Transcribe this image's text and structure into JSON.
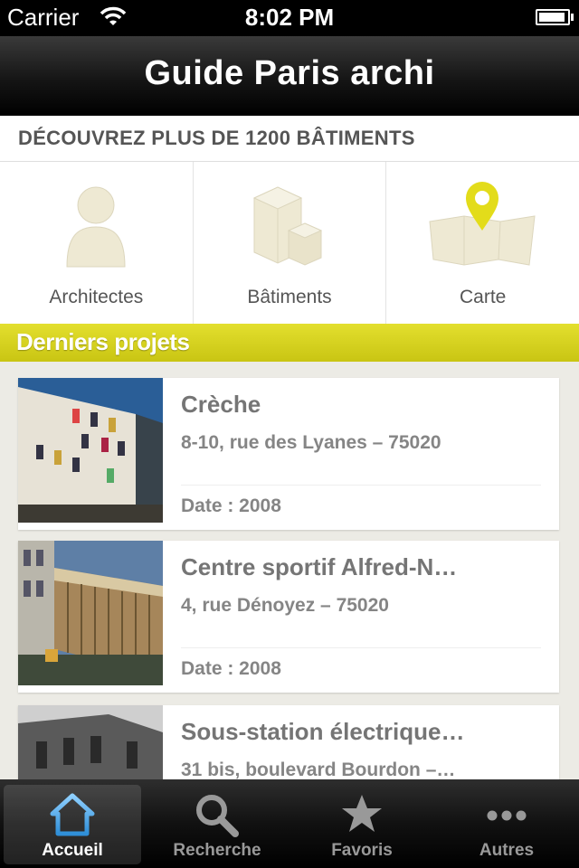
{
  "status_bar": {
    "carrier": "Carrier",
    "time": "8:02 PM"
  },
  "navbar": {
    "title": "Guide Paris archi"
  },
  "discover": {
    "text": "DÉCOUVREZ PLUS DE 1200 BÂTIMENTS"
  },
  "tiles": [
    {
      "label": "Architectes",
      "icon": "person-icon"
    },
    {
      "label": "Bâtiments",
      "icon": "buildings-icon"
    },
    {
      "label": "Carte",
      "icon": "map-pin-icon"
    }
  ],
  "section": {
    "title": "Derniers projets"
  },
  "projects": [
    {
      "name": "Crèche",
      "address": "8-10, rue des Lyanes – 75020",
      "date": "Date : 2008"
    },
    {
      "name": "Centre sportif Alfred-N…",
      "address": "4, rue Dénoyez – 75020",
      "date": "Date : 2008"
    },
    {
      "name": "Sous-station électrique…",
      "address": "31 bis, boulevard Bourdon –…",
      "date": ""
    }
  ],
  "tabbar": {
    "items": [
      {
        "label": "Accueil",
        "icon": "home-icon"
      },
      {
        "label": "Recherche",
        "icon": "search-icon"
      },
      {
        "label": "Favoris",
        "icon": "star-icon"
      },
      {
        "label": "Autres",
        "icon": "more-icon"
      }
    ],
    "active_index": 0
  },
  "colors": {
    "accent_yellow": "#d6d21f",
    "tab_active": "#4aa8e8",
    "tile_icon": "#eee9d3"
  }
}
